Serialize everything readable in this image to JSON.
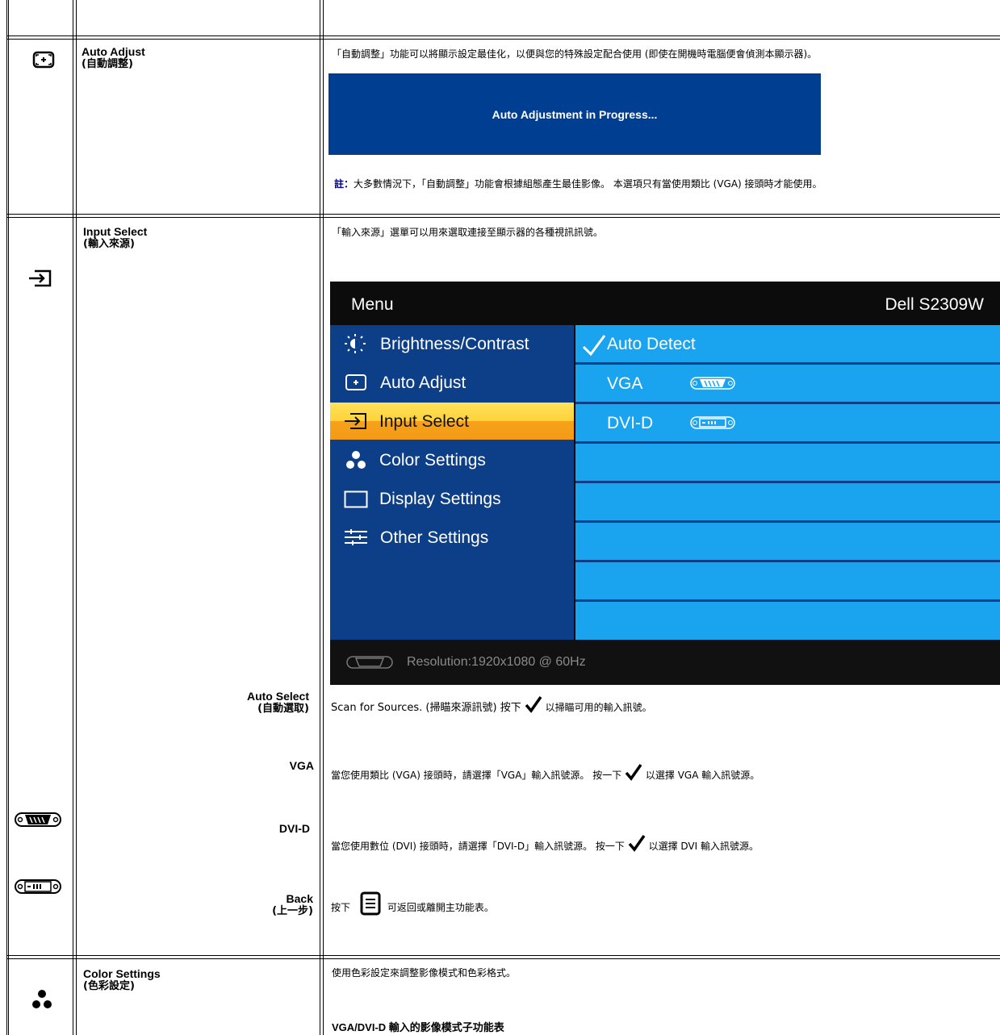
{
  "auto_adjust": {
    "title": "Auto Adjust",
    "title_cjk": "(自動調整)",
    "description": "「自動調整」功能可以將顯示設定最佳化，以便與您的特殊設定配合使用 (即使在開機時電腦便會偵測本顯示器)。",
    "banner_text": "Auto Adjustment in Progress...",
    "note_label": "註：",
    "note_text": "大多數情況下，「自動調整」功能會根據組態產生最佳影像。 本選項只有當使用類比 (VGA) 接頭時才能使用。",
    "banner_color": "#003e92"
  },
  "input_select": {
    "title": "Input Select",
    "title_cjk": "(輸入來源)",
    "description": "「輸入來源」選單可以用來選取連接至顯示器的各種視訊訊號。",
    "osd": {
      "menu_title": "Menu",
      "model": "Dell S2309W",
      "left_items": [
        {
          "label": "Brightness/Contrast",
          "icon": "sun-icon"
        },
        {
          "label": "Auto Adjust",
          "icon": "auto-adjust-icon"
        },
        {
          "label": "Input Select",
          "icon": "input-select-icon"
        },
        {
          "label": "Color Settings",
          "icon": "color-dots-icon"
        },
        {
          "label": "Display Settings",
          "icon": "display-rect-icon"
        },
        {
          "label": "Other Settings",
          "icon": "sliders-icon"
        }
      ],
      "right_items": [
        {
          "label": "Auto Detect",
          "icon": "checkmark-icon"
        },
        {
          "label": "VGA",
          "icon": "vga-connector-icon"
        },
        {
          "label": "DVI-D",
          "icon": "dvi-connector-icon"
        }
      ],
      "resolution": "Resolution:1920x1080 @ 60Hz",
      "selected_color": "#f7a21a",
      "highlight_color": "#1aa3ee"
    },
    "rows": [
      {
        "label": "Auto Select",
        "label_cjk": "(自動選取)",
        "text_before": "Scan for Sources. (掃瞄來源訊號) 按下",
        "text_after": " 以掃瞄可用的輸入訊號。"
      },
      {
        "label": "VGA",
        "text_before": "當您使用類比 (VGA) 接頭時，請選擇「VGA」輸入訊號源。 按一下",
        "text_after": " 以選擇 VGA 輸入訊號源。"
      },
      {
        "label": "DVI-D",
        "text_before": "當您使用數位 (DVI) 接頭時，請選擇「DVI-D」輸入訊號源。 按一下",
        "text_after": " 以選擇 DVI 輸入訊號源。"
      },
      {
        "label": "Back",
        "label_cjk": "(上一步)",
        "text_before": "按下",
        "text_after": " 可返回或離開主功能表。"
      }
    ]
  },
  "color_settings": {
    "title": "Color Settings",
    "title_cjk": "(色彩設定)",
    "description": "使用色彩設定來調整影像模式和色彩格式。",
    "submenu_heading": "VGA/DVI-D 輸入的影像模式子功能表"
  }
}
